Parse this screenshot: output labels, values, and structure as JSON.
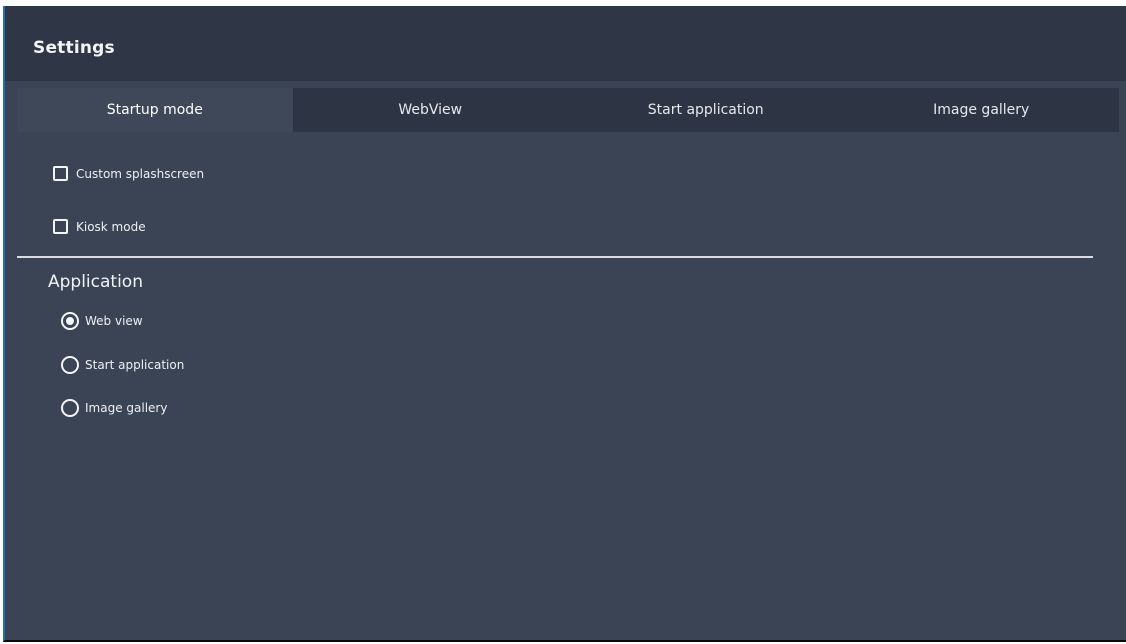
{
  "window": {
    "title": "Settings"
  },
  "tabs": [
    {
      "label": "Startup mode",
      "active": true
    },
    {
      "label": "WebView",
      "active": false
    },
    {
      "label": "Start application",
      "active": false
    },
    {
      "label": "Image gallery",
      "active": false
    }
  ],
  "startup": {
    "custom_splash_label": "Custom splashscreen",
    "custom_splash_checked": false,
    "kiosk_label": "Kiosk mode",
    "kiosk_checked": false
  },
  "application": {
    "title": "Application",
    "options": [
      {
        "label": "Web view",
        "selected": true
      },
      {
        "label": "Start application",
        "selected": false
      },
      {
        "label": "Image gallery",
        "selected": false
      }
    ]
  },
  "colors": {
    "window_bg": "#3b4455",
    "titlebar_bg": "#2f3646",
    "tab_bg": "#2d3443",
    "tab_active_bg": "#3f4859",
    "accent_border": "#1f6fb5",
    "text": "#eef0f3"
  }
}
